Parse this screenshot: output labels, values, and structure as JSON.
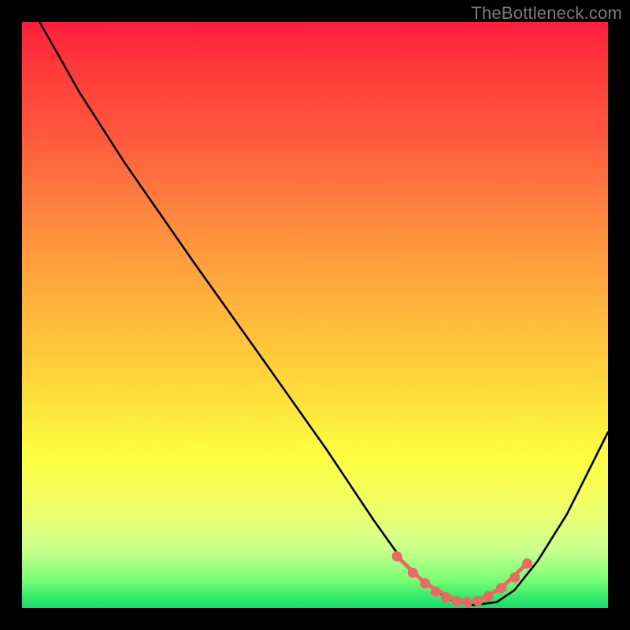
{
  "watermark": "TheBottleneck.com",
  "chart_data": {
    "type": "line",
    "title": "",
    "xlabel": "",
    "ylabel": "",
    "xlim": [
      0,
      1
    ],
    "ylim": [
      0,
      1
    ],
    "series": [
      {
        "name": "curve",
        "x": [
          0.03,
          0.098,
          0.175,
          0.293,
          0.414,
          0.52,
          0.6,
          0.65,
          0.69,
          0.73,
          0.77,
          0.81,
          0.84,
          0.88,
          0.93,
          1.0
        ],
        "values": [
          1.0,
          0.88,
          0.76,
          0.59,
          0.42,
          0.27,
          0.15,
          0.08,
          0.04,
          0.015,
          0.005,
          0.01,
          0.03,
          0.08,
          0.16,
          0.3
        ]
      }
    ],
    "markers": {
      "name": "highlight-dots",
      "color": "#e96a62",
      "x": [
        0.64,
        0.667,
        0.688,
        0.706,
        0.724,
        0.742,
        0.76,
        0.778,
        0.796,
        0.818,
        0.841,
        0.862
      ],
      "values": [
        0.088,
        0.06,
        0.042,
        0.028,
        0.018,
        0.012,
        0.01,
        0.012,
        0.02,
        0.034,
        0.052,
        0.076
      ]
    },
    "marker_line": {
      "name": "highlight-line",
      "color": "#e96a62",
      "x": [
        0.64,
        0.688,
        0.742,
        0.778,
        0.818,
        0.862
      ],
      "values": [
        0.088,
        0.042,
        0.012,
        0.012,
        0.034,
        0.076
      ]
    },
    "gradient_stops": [
      {
        "pos": 0.0,
        "color": "#ff1e3c"
      },
      {
        "pos": 0.5,
        "color": "#ffc23a"
      },
      {
        "pos": 0.8,
        "color": "#feff40"
      },
      {
        "pos": 1.0,
        "color": "#18dc65"
      }
    ]
  }
}
